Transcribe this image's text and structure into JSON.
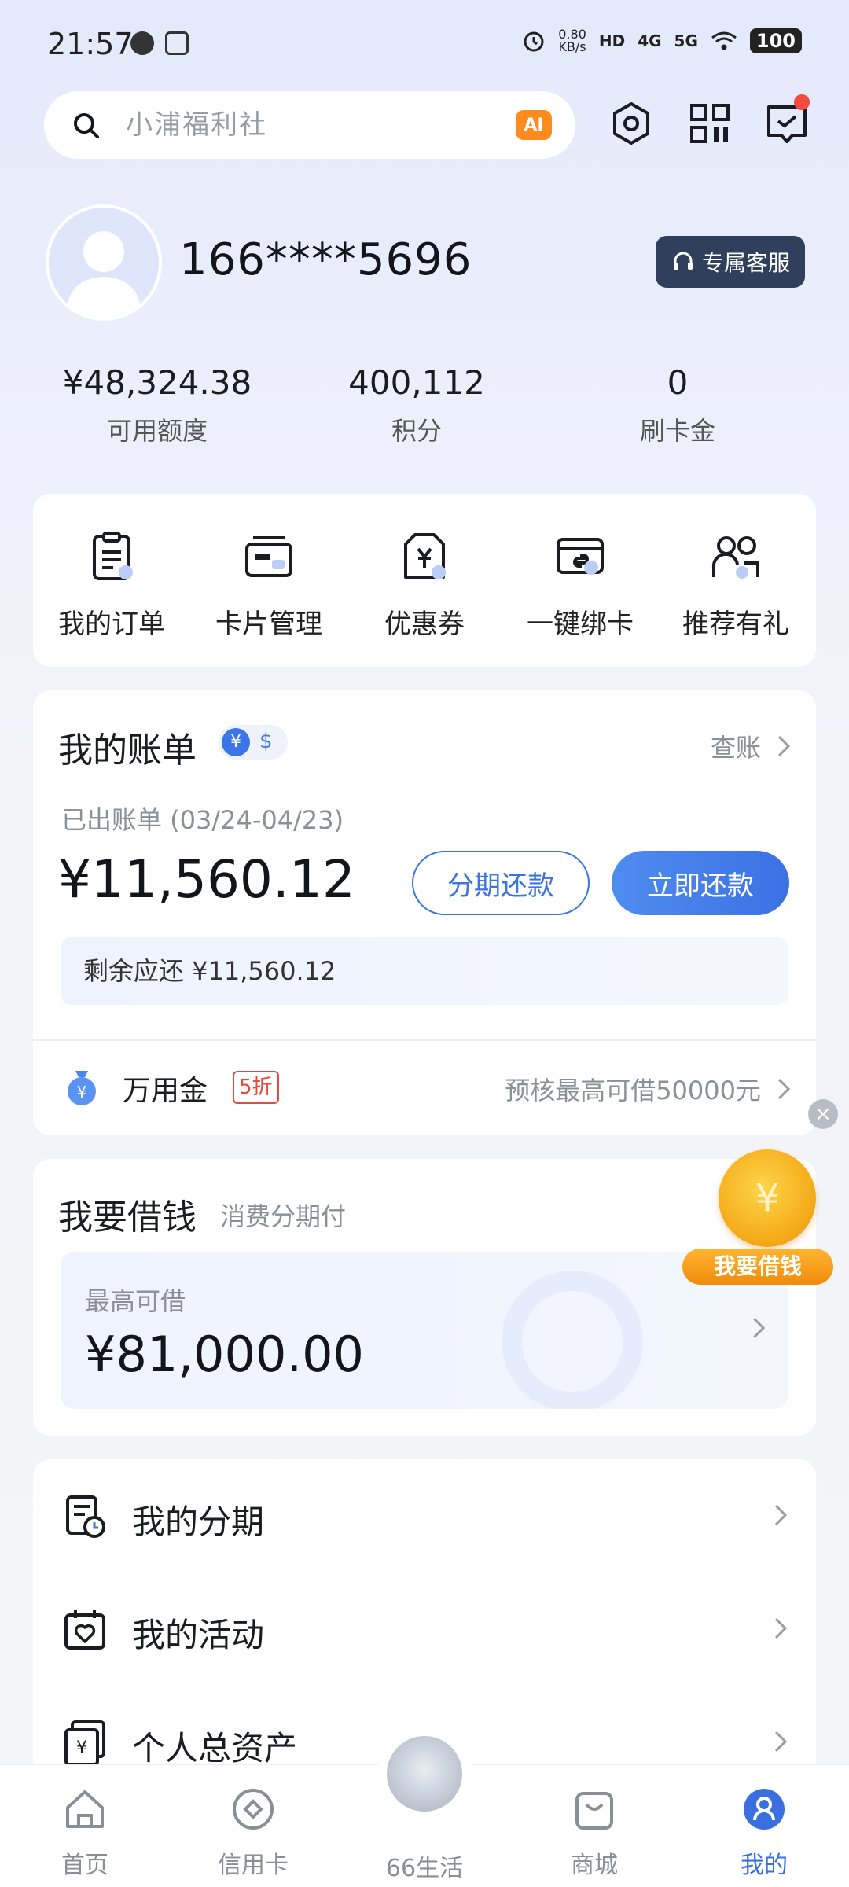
{
  "status_bar": {
    "time": "21:57",
    "net_speed": "0.80",
    "net_unit": "KB/s",
    "hd": "HD",
    "sig1": "4G",
    "sig2": "5G",
    "battery": "100"
  },
  "search": {
    "placeholder": "小浦福利社",
    "ai_label": "AI"
  },
  "profile": {
    "phone": "166****5696",
    "service_label": "专属客服"
  },
  "stats": [
    {
      "value": "¥48,324.38",
      "label": "可用额度"
    },
    {
      "value": "400,112",
      "label": "积分"
    },
    {
      "value": "0",
      "label": "刷卡金"
    }
  ],
  "quick_actions": [
    {
      "label": "我的订单",
      "icon": "order-icon"
    },
    {
      "label": "卡片管理",
      "icon": "card-icon"
    },
    {
      "label": "优惠券",
      "icon": "coupon-icon"
    },
    {
      "label": "一键绑卡",
      "icon": "bind-card-icon"
    },
    {
      "label": "推荐有礼",
      "icon": "referral-icon"
    }
  ],
  "bill": {
    "title": "我的账单",
    "currency_yen": "¥",
    "currency_usd": "$",
    "check_label": "查账",
    "period": "已出账单 (03/24-04/23)",
    "amount": "¥11,560.12",
    "installment_button": "分期还款",
    "pay_button": "立即还款",
    "remaining": "剩余应还 ¥11,560.12",
    "wanyongjin_label": "万用金",
    "wanyongjin_badge": "5折",
    "wanyongjin_desc": "预核最高可借50000元"
  },
  "borrow": {
    "title": "我要借钱",
    "subtitle": "消费分期付",
    "max_label": "最高可借",
    "max_value": "¥81,000.00",
    "float_coin": "¥",
    "float_label": "我要借钱",
    "close": "×"
  },
  "menu": [
    {
      "label": "我的分期",
      "icon": "installment-icon"
    },
    {
      "label": "我的活动",
      "icon": "activity-icon"
    },
    {
      "label": "个人总资产",
      "icon": "assets-icon"
    }
  ],
  "tabs": [
    {
      "label": "首页",
      "icon": "home-icon"
    },
    {
      "label": "信用卡",
      "icon": "credit-card-icon"
    },
    {
      "label": "66生活",
      "icon": "mascot-icon"
    },
    {
      "label": "商城",
      "icon": "shop-icon"
    },
    {
      "label": "我的",
      "icon": "profile-icon",
      "active": true
    }
  ],
  "colors": {
    "accent": "#3c74e2",
    "alert": "#e44a3d",
    "orange": "#f4a816"
  }
}
